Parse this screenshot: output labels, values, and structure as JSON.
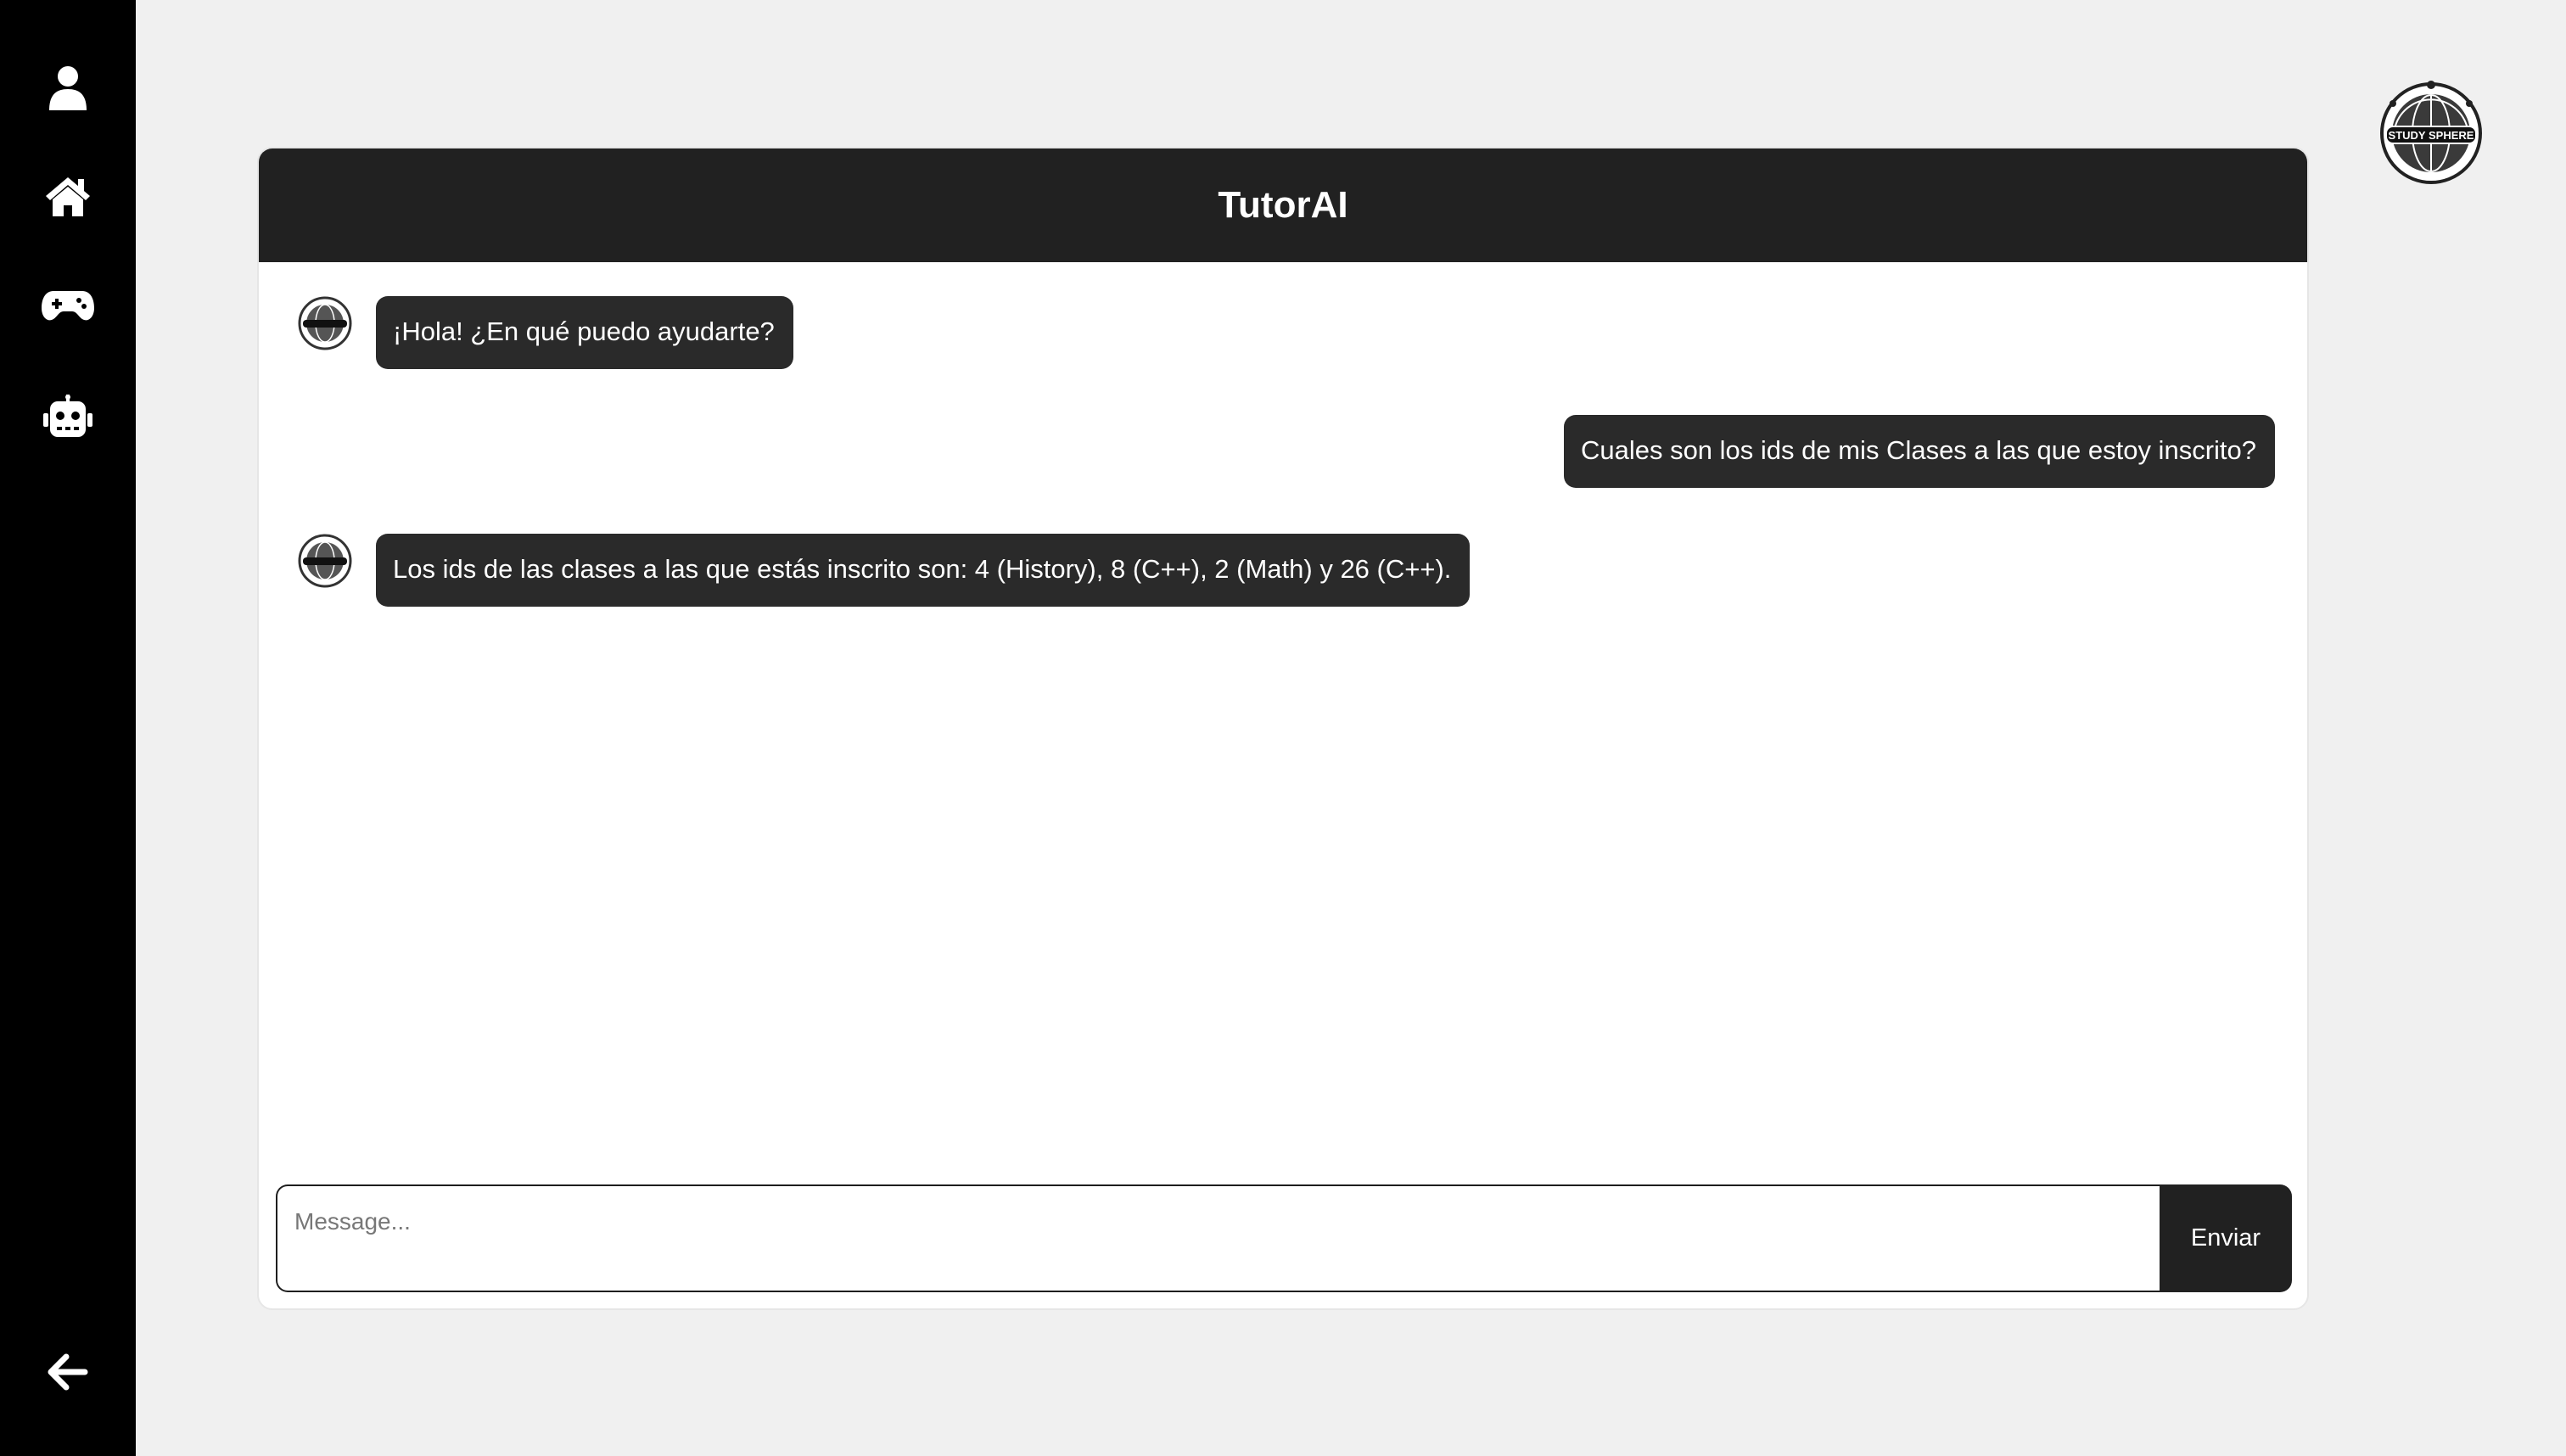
{
  "sidebar": {
    "items": [
      {
        "icon": "user-icon"
      },
      {
        "icon": "home-icon"
      },
      {
        "icon": "gamepad-icon"
      },
      {
        "icon": "robot-icon"
      },
      {
        "icon": "arrow-left-icon"
      }
    ]
  },
  "brand": {
    "logo_text": "STUDY SPHERE"
  },
  "chat": {
    "title": "TutorAI",
    "messages": [
      {
        "role": "bot",
        "text": "¡Hola! ¿En qué puedo ayudarte?"
      },
      {
        "role": "user",
        "text": "Cuales son los ids de mis Clases a las que estoy inscrito?"
      },
      {
        "role": "bot",
        "text": "Los ids de las clases a las que estás inscrito son: 4 (History), 8 (C++), 2 (Math) y 26 (C++)."
      }
    ],
    "input": {
      "placeholder": "Message...",
      "value": ""
    },
    "send_label": "Enviar"
  },
  "colors": {
    "sidebar_bg": "#000000",
    "header_bg": "#212121",
    "bubble_bg": "#2a2a2a",
    "page_bg": "#f0f0f0"
  }
}
